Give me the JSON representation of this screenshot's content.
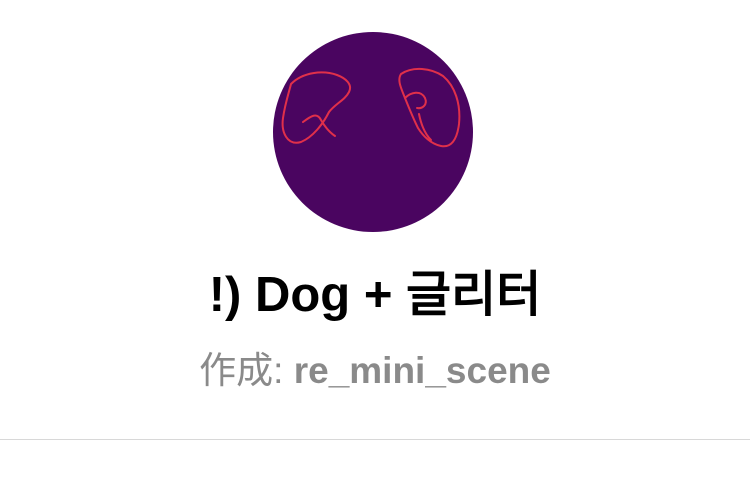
{
  "profile": {
    "avatar": {
      "background_color": "#4a0560",
      "stroke_color": "#e0304a"
    },
    "title": "!) Dog + 글리터",
    "creator_label": "作成: ",
    "creator_name": "re_mini_scene"
  },
  "colors": {
    "title_text": "#000000",
    "subtitle_text": "#8a8a8a",
    "divider": "#d8d8d8",
    "page_background": "#ffffff"
  }
}
